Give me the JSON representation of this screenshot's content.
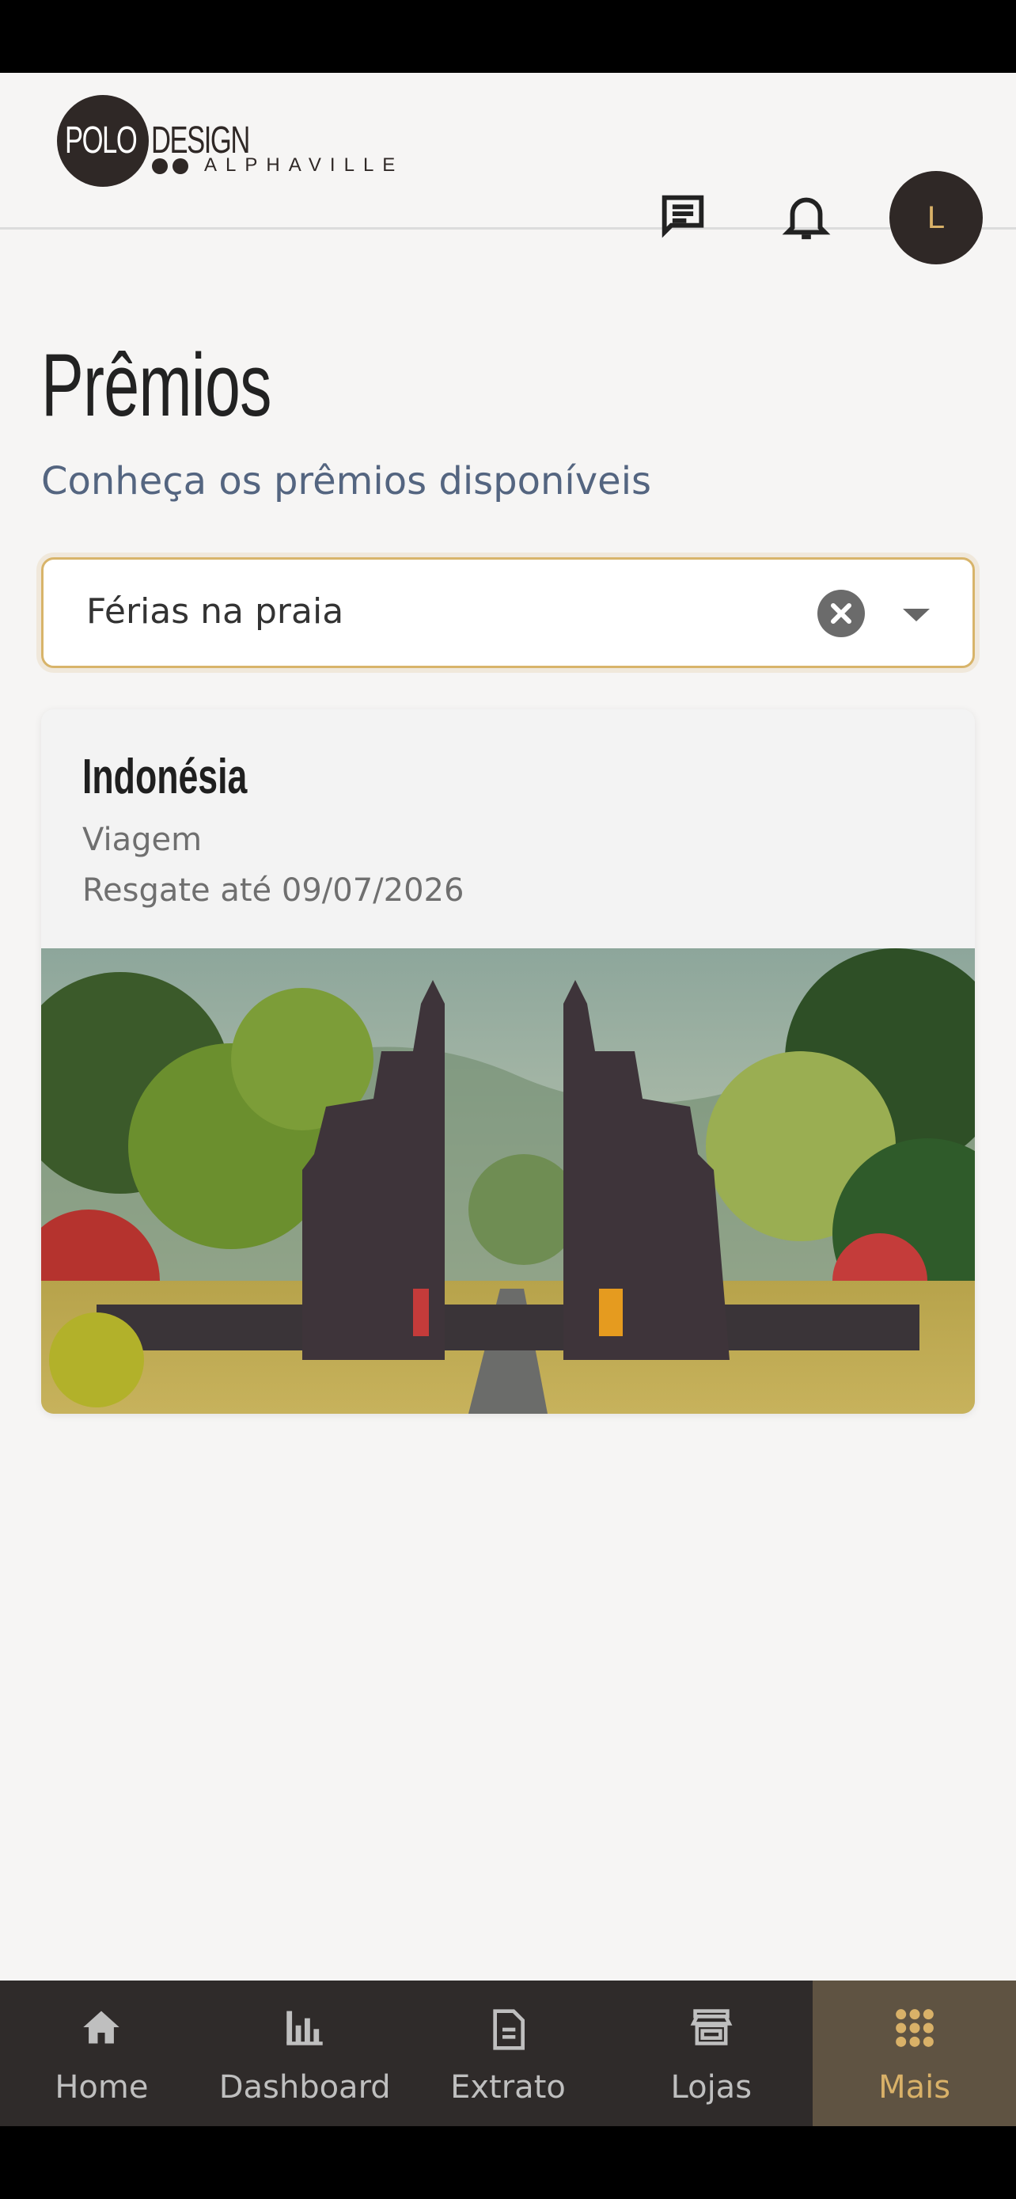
{
  "brand": {
    "logo_word_1": "POLO",
    "logo_word_2": "DESIGN",
    "logo_sub": "ALPHAVILLE"
  },
  "header": {
    "avatar_initial": "L",
    "icons": [
      "chat-icon",
      "bell-icon"
    ]
  },
  "page": {
    "title": "Prêmios",
    "subtitle": "Conheça os prêmios disponíveis"
  },
  "filter": {
    "selected": "Férias na praia",
    "icons": [
      "clear-icon",
      "caret-down-icon"
    ]
  },
  "prizes": [
    {
      "title": "Indonésia",
      "category": "Viagem",
      "deadline": "Resgate até 09/07/2026",
      "image": "temple-gate-photo"
    }
  ],
  "nav": [
    {
      "label": "Home",
      "icon": "home-icon"
    },
    {
      "label": "Dashboard",
      "icon": "bar-chart-icon"
    },
    {
      "label": "Extrato",
      "icon": "document-icon"
    },
    {
      "label": "Lojas",
      "icon": "store-icon"
    },
    {
      "label": "Mais",
      "icon": "grid-icon",
      "active": true
    }
  ],
  "colors": {
    "accent": "#d9b168",
    "dark": "#2f2826",
    "tabbar": "#2f2b2a",
    "tab_active_bg": "#5f5342",
    "subtitle": "#546580"
  }
}
